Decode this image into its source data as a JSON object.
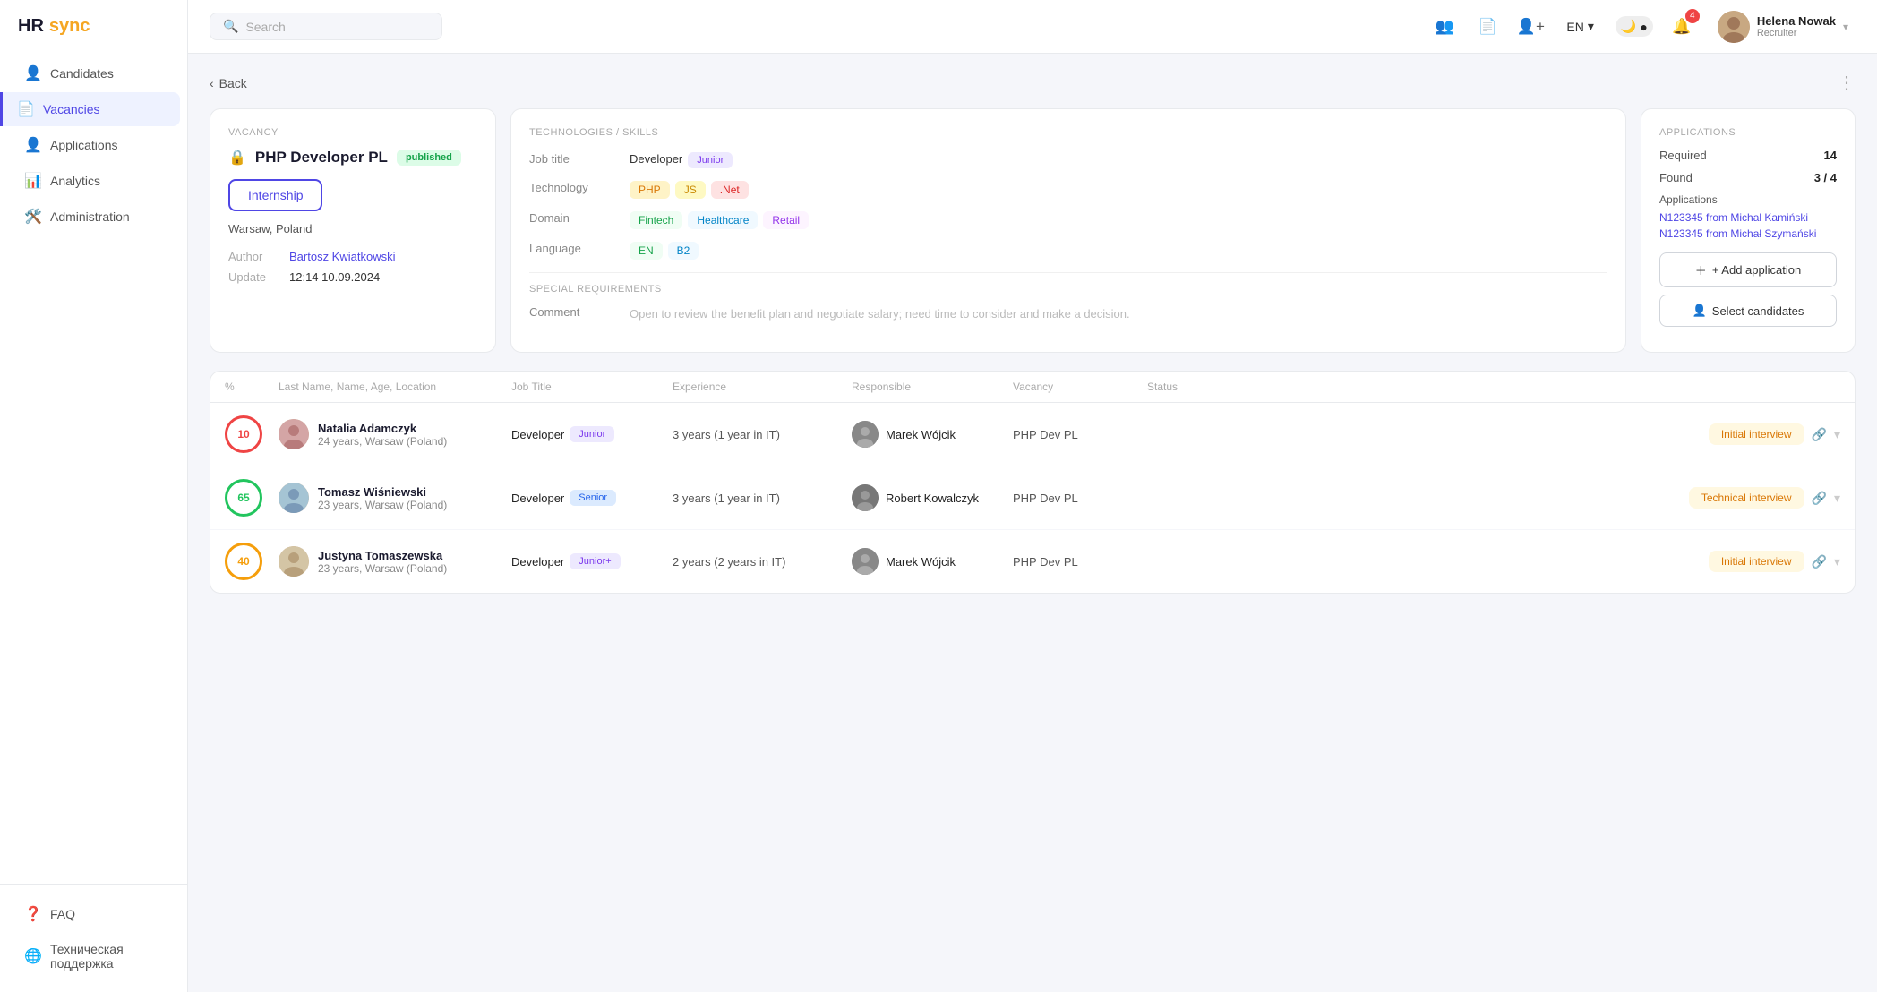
{
  "app": {
    "name": "HR",
    "name_sync": "sync",
    "logo_text": "HRsync"
  },
  "sidebar": {
    "items": [
      {
        "id": "candidates",
        "label": "Candidates",
        "icon": "👤"
      },
      {
        "id": "vacancies",
        "label": "Vacancies",
        "icon": "📄",
        "active": true
      },
      {
        "id": "applications",
        "label": "Applications",
        "icon": "👤"
      },
      {
        "id": "analytics",
        "label": "Analytics",
        "icon": "📊"
      },
      {
        "id": "administration",
        "label": "Administration",
        "icon": "🛠️"
      }
    ],
    "bottom": [
      {
        "id": "faq",
        "label": "FAQ",
        "icon": "❓"
      },
      {
        "id": "support",
        "label": "Техническая поддержка",
        "icon": "🌐"
      }
    ]
  },
  "header": {
    "search_placeholder": "Search",
    "lang": "EN",
    "notifications_count": "4",
    "user_name": "Helena Nowak",
    "user_role": "Recruiter"
  },
  "back_label": "Back",
  "more_icon": "⋮",
  "vacancy": {
    "section_label": "Vacancy",
    "title": "PHP Developer PL",
    "status": "published",
    "type": "Internship",
    "location": "Warsaw, Poland",
    "author_label": "Author",
    "author_name": "Bartosz Kwiatkowski",
    "update_label": "Update",
    "update_value": "12:14 10.09.2024"
  },
  "skills": {
    "section_label": "Technologies / skills",
    "job_title_label": "Job title",
    "job_title_value": "Developer",
    "job_title_level": "Junior",
    "technology_label": "Technology",
    "technologies": [
      "PHP",
      "JS",
      ".Net"
    ],
    "domain_label": "Domain",
    "domains": [
      "Fintech",
      "Healthcare",
      "Retail"
    ],
    "language_label": "Language",
    "languages": [
      "EN",
      "B2"
    ]
  },
  "special": {
    "section_label": "Special requirements",
    "comment_label": "Comment",
    "comment_text": "Open to review the benefit plan and negotiate salary; need time to consider and make a decision."
  },
  "applications_panel": {
    "section_label": "Applications",
    "required_label": "Required",
    "required_value": "14",
    "found_label": "Found",
    "found_value": "3 / 4",
    "applications_label": "Applications",
    "app_links": [
      "N123345 from Michał Kamiński",
      "N123345 from Michał Szymański"
    ],
    "add_btn": "+ Add application",
    "select_btn": "Select candidates"
  },
  "table": {
    "columns": [
      "%",
      "Last Name, Name, Age, Location",
      "Job Title",
      "Experience",
      "Responsible",
      "Vacancy",
      "Status"
    ],
    "rows": [
      {
        "percent": "10",
        "percent_class": "circle-low",
        "name": "Natalia Adamczyk",
        "age_location": "24 years, Warsaw (Poland)",
        "job_title": "Developer",
        "job_level": "Junior",
        "experience": "3 years (1 year in IT)",
        "responsible_name": "Marek Wójcik",
        "vacancy": "PHP Dev PL",
        "status": "Initial interview",
        "status_class": "status-badge-interview"
      },
      {
        "percent": "65",
        "percent_class": "circle-med",
        "name": "Tomasz Wiśniewski",
        "age_location": "23 years, Warsaw (Poland)",
        "job_title": "Developer",
        "job_level": "Senior",
        "experience": "3 years (1 year in IT)",
        "responsible_name": "Robert Kowalczyk",
        "vacancy": "PHP Dev PL",
        "status": "Technical interview",
        "status_class": "status-badge-technical"
      },
      {
        "percent": "40",
        "percent_class": "circle-mid",
        "name": "Justyna Tomaszewska",
        "age_location": "23 years, Warsaw (Poland)",
        "job_title": "Developer",
        "job_level": "Junior+",
        "experience": "2 years (2 years in IT)",
        "responsible_name": "Marek Wójcik",
        "vacancy": "PHP Dev PL",
        "status": "Initial interview",
        "status_class": "status-badge-interview"
      }
    ]
  }
}
